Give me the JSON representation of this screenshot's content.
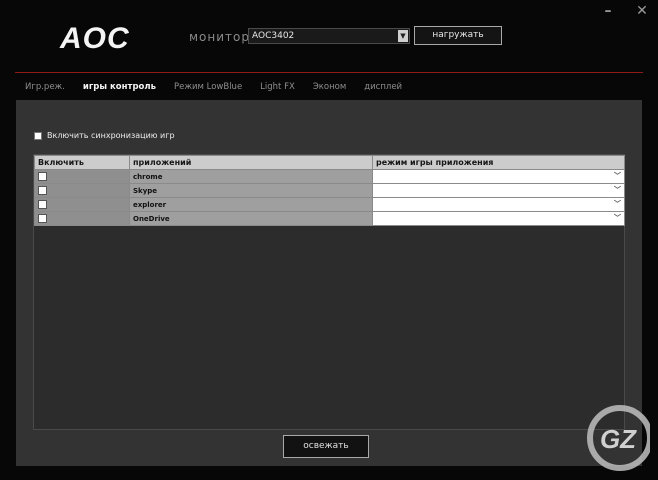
{
  "window": {
    "minimize_label": "–",
    "close_label": "✕"
  },
  "header": {
    "logo": "AOC",
    "monitor_label": "монитор",
    "monitor_value": "AOC3402",
    "load_label": "нагружать"
  },
  "tabs": [
    {
      "label": "Игр.реж.",
      "active": false
    },
    {
      "label": "игры контроль",
      "active": true
    },
    {
      "label": "Режим LowBlue",
      "active": false
    },
    {
      "label": "Light FX",
      "active": false
    },
    {
      "label": "Эконом",
      "active": false
    },
    {
      "label": "дисплей",
      "active": false
    }
  ],
  "sync": {
    "label": "Включить синхронизацию игр",
    "checked": false
  },
  "table": {
    "headers": [
      "Включить",
      "приложений",
      "режим игры приложения"
    ],
    "rows": [
      {
        "app": "chrome",
        "mode": ""
      },
      {
        "app": "Skype",
        "mode": ""
      },
      {
        "app": "explorer",
        "mode": ""
      },
      {
        "app": "OneDrive",
        "mode": ""
      }
    ]
  },
  "footer": {
    "apply_label": "освежать"
  },
  "watermark": {
    "text": "GZ"
  }
}
